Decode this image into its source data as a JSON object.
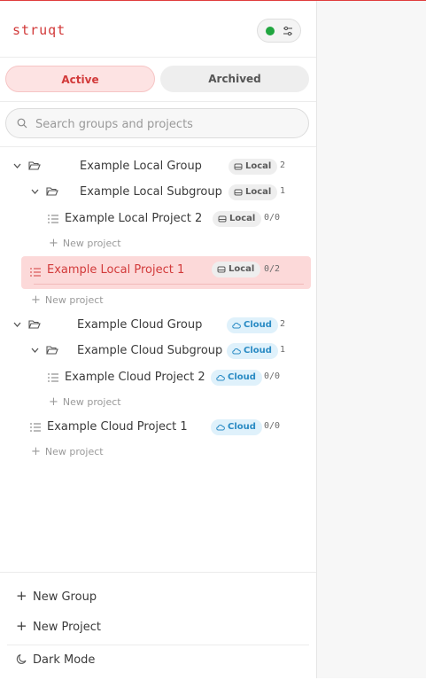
{
  "app": {
    "logo": "struqt",
    "status_color": "#21a640"
  },
  "tabs": {
    "active": "Active",
    "archived": "Archived"
  },
  "search": {
    "placeholder": "Search groups and projects",
    "value": ""
  },
  "tree": {
    "local_group": {
      "label": "Example Local Group",
      "badge": "Local",
      "count": "2"
    },
    "local_subgroup": {
      "label": "Example Local Subgroup",
      "badge": "Local",
      "count": "1"
    },
    "local_project_2": {
      "label": "Example Local Project 2",
      "badge": "Local",
      "progress": "0/0"
    },
    "local_subgroup_new": "New project",
    "local_project_1": {
      "label": "Example Local Project 1",
      "badge": "Local",
      "progress": "0/2"
    },
    "local_group_new": "New project",
    "cloud_group": {
      "label": "Example Cloud Group",
      "badge": "Cloud",
      "count": "2"
    },
    "cloud_subgroup": {
      "label": "Example Cloud Subgroup",
      "badge": "Cloud",
      "count": "1"
    },
    "cloud_project_2": {
      "label": "Example Cloud Project 2",
      "badge": "Cloud",
      "progress": "0/0"
    },
    "cloud_subgroup_new": "New project",
    "cloud_project_1": {
      "label": "Example Cloud Project 1",
      "badge": "Cloud",
      "progress": "0/0"
    },
    "root_new": "New project"
  },
  "footer": {
    "new_group": "New Group",
    "new_project": "New Project",
    "dark_mode": "Dark Mode"
  },
  "colors": {
    "accent": "#d23a3a",
    "selected_bg": "#fcd9d9",
    "cloud_badge": "#2a8bc4"
  }
}
